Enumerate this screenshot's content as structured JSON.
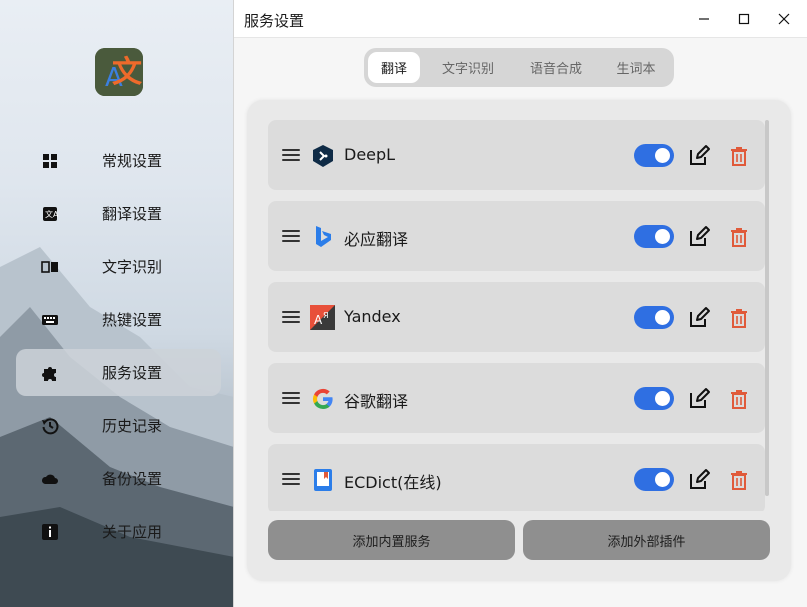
{
  "window": {
    "title": "服务设置",
    "controls": {
      "minimize": "minimize-icon",
      "maximize": "maximize-icon",
      "close": "close-icon"
    }
  },
  "sidebar": {
    "logo_text": "文",
    "logo_sub": "A",
    "items": [
      {
        "label": "常规设置",
        "icon": "grid-icon",
        "active": false
      },
      {
        "label": "翻译设置",
        "icon": "translate-icon",
        "active": false
      },
      {
        "label": "文字识别",
        "icon": "ocr-icon",
        "active": false
      },
      {
        "label": "热键设置",
        "icon": "keyboard-icon",
        "active": false
      },
      {
        "label": "服务设置",
        "icon": "puzzle-icon",
        "active": true
      },
      {
        "label": "历史记录",
        "icon": "history-icon",
        "active": false
      },
      {
        "label": "备份设置",
        "icon": "cloud-icon",
        "active": false
      },
      {
        "label": "关于应用",
        "icon": "info-icon",
        "active": false
      }
    ]
  },
  "tabs": [
    {
      "label": "翻译",
      "active": true
    },
    {
      "label": "文字识别",
      "active": false
    },
    {
      "label": "语音合成",
      "active": false
    },
    {
      "label": "生词本",
      "active": false
    }
  ],
  "services": [
    {
      "name": "DeepL",
      "icon": "deepl-icon",
      "enabled": true
    },
    {
      "name": "必应翻译",
      "icon": "bing-icon",
      "enabled": true
    },
    {
      "name": "Yandex",
      "icon": "yandex-icon",
      "enabled": true
    },
    {
      "name": "谷歌翻译",
      "icon": "google-icon",
      "enabled": true
    },
    {
      "name": "ECDict(在线)",
      "icon": "ecdict-icon",
      "enabled": true
    }
  ],
  "buttons": {
    "add_builtin": "添加内置服务",
    "add_external": "添加外部插件"
  },
  "colors": {
    "accent": "#2f6fe2",
    "delete": "#e05a3a",
    "active_nav": "#cdd2d8"
  }
}
